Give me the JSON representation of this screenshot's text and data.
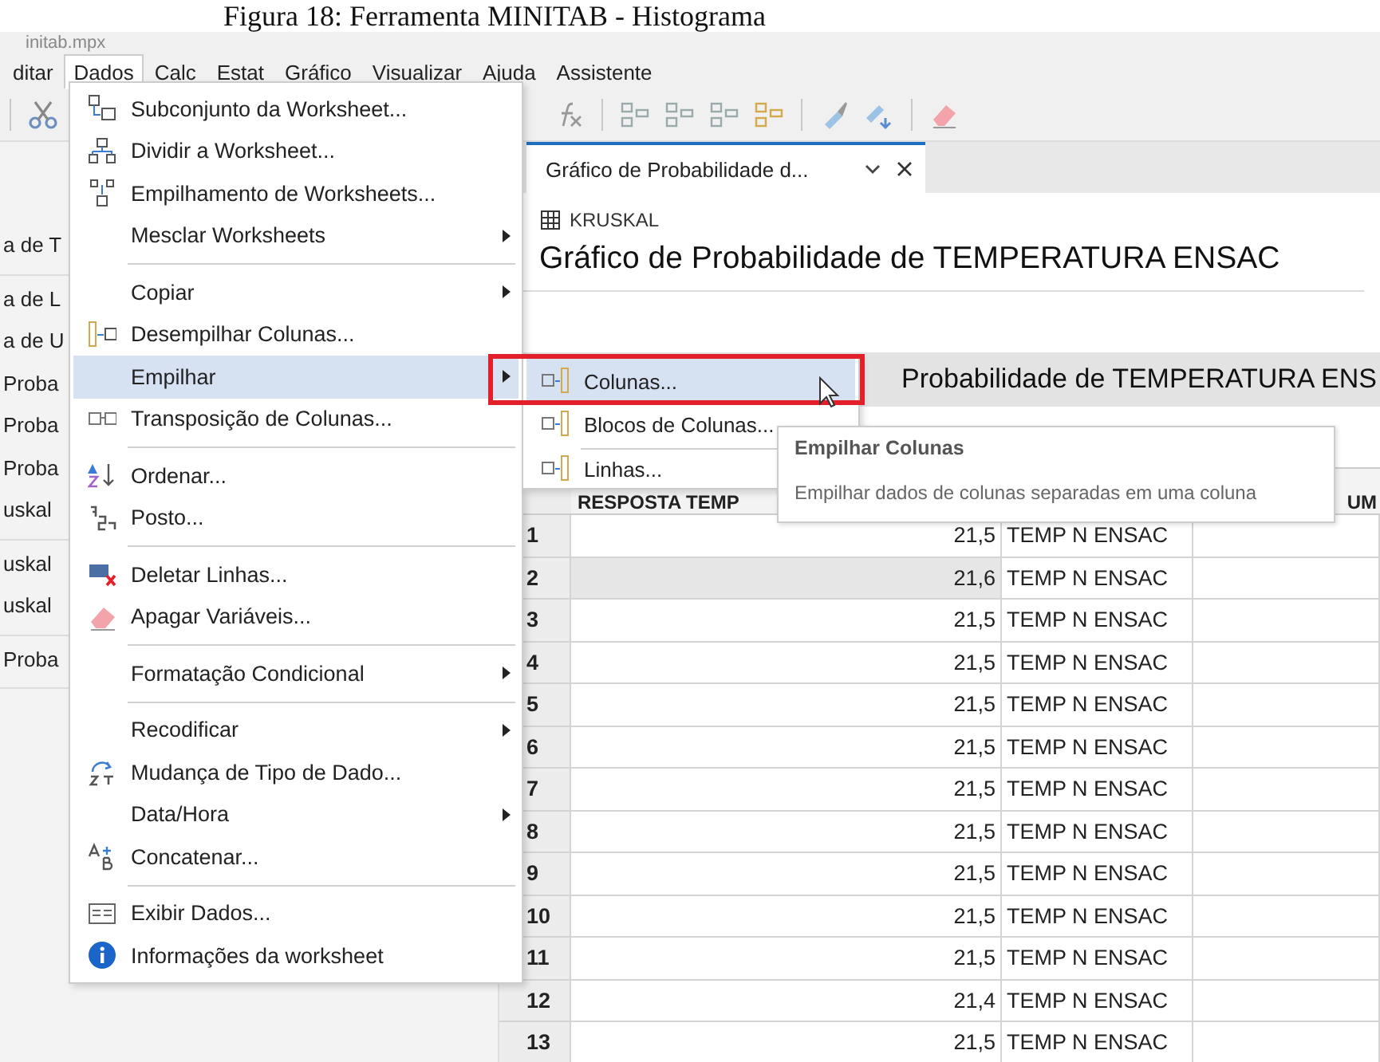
{
  "caption": "Figura 18: Ferramenta MINITAB - Histograma",
  "window": {
    "title": "initab.mpx"
  },
  "menubar": [
    {
      "label": "ditar",
      "selected": false
    },
    {
      "label": "Dados",
      "selected": true
    },
    {
      "label": "Calc",
      "selected": false
    },
    {
      "label": "Estat",
      "selected": false
    },
    {
      "label": "Gráfico",
      "selected": false
    },
    {
      "label": "Visualizar",
      "selected": false
    },
    {
      "label": "Ajuda",
      "selected": false
    },
    {
      "label": "Assistente",
      "selected": false
    }
  ],
  "navigator": {
    "groups": [
      [
        {
          "label": "a de T"
        }
      ],
      [
        {
          "label": "a de L"
        },
        {
          "label": "a de U"
        },
        {
          "label": "Proba"
        },
        {
          "label": "Proba"
        },
        {
          "label": "Proba"
        },
        {
          "label": "uskal"
        }
      ],
      [
        {
          "label": "uskal"
        },
        {
          "label": "uskal"
        }
      ],
      [
        {
          "label": "Proba"
        }
      ]
    ]
  },
  "document_tab": {
    "label": "Gráfico de Probabilidade d...",
    "selected": true
  },
  "worksheet": {
    "name": "KRUSKAL"
  },
  "output_title": "Gráfico de Probabilidade de TEMPERATURA ENSAC",
  "section_title": "Probabilidade de TEMPERATURA ENS",
  "table": {
    "header_1": "RESPOSTA TEMP",
    "header_3": "UM",
    "rows": [
      {
        "number": "1",
        "value": "21,5",
        "label": "TEMP N ENSAC",
        "selected": false
      },
      {
        "number": "2",
        "value": "21,6",
        "label": "TEMP N ENSAC",
        "selected": true
      },
      {
        "number": "3",
        "value": "21,5",
        "label": "TEMP N ENSAC",
        "selected": false
      },
      {
        "number": "4",
        "value": "21,5",
        "label": "TEMP N ENSAC",
        "selected": false
      },
      {
        "number": "5",
        "value": "21,5",
        "label": "TEMP N ENSAC",
        "selected": false
      },
      {
        "number": "6",
        "value": "21,5",
        "label": "TEMP N ENSAC",
        "selected": false
      },
      {
        "number": "7",
        "value": "21,5",
        "label": "TEMP N ENSAC",
        "selected": false
      },
      {
        "number": "8",
        "value": "21,5",
        "label": "TEMP N ENSAC",
        "selected": false
      },
      {
        "number": "9",
        "value": "21,5",
        "label": "TEMP N ENSAC",
        "selected": false
      },
      {
        "number": "10",
        "value": "21,5",
        "label": "TEMP N ENSAC",
        "selected": false
      },
      {
        "number": "11",
        "value": "21,5",
        "label": "TEMP N ENSAC",
        "selected": false
      },
      {
        "number": "12",
        "value": "21,4",
        "label": "TEMP N ENSAC",
        "selected": false
      },
      {
        "number": "13",
        "value": "21,5",
        "label": "TEMP N ENSAC",
        "selected": false
      }
    ]
  },
  "data_menu": {
    "items": [
      {
        "kind": "item",
        "label": "Subconjunto da Worksheet...",
        "submenu": false,
        "selected": false
      },
      {
        "kind": "item",
        "label": "Dividir a Worksheet...",
        "submenu": false,
        "selected": false
      },
      {
        "kind": "item",
        "label": "Empilhamento de Worksheets...",
        "submenu": false,
        "selected": false
      },
      {
        "kind": "item",
        "label": "Mesclar Worksheets",
        "submenu": true,
        "selected": false
      },
      {
        "kind": "separator"
      },
      {
        "kind": "item",
        "label": "Copiar",
        "submenu": true,
        "selected": false
      },
      {
        "kind": "item",
        "label": "Desempilhar Colunas...",
        "submenu": false,
        "selected": false
      },
      {
        "kind": "item",
        "label": "Empilhar",
        "submenu": true,
        "selected": true
      },
      {
        "kind": "item",
        "label": "Transposição de Colunas...",
        "submenu": false,
        "selected": false
      },
      {
        "kind": "separator"
      },
      {
        "kind": "item",
        "label": "Ordenar...",
        "submenu": false,
        "selected": false
      },
      {
        "kind": "item",
        "label": "Posto...",
        "submenu": false,
        "selected": false
      },
      {
        "kind": "separator"
      },
      {
        "kind": "item",
        "label": "Deletar Linhas...",
        "submenu": false,
        "selected": false
      },
      {
        "kind": "item",
        "label": "Apagar Variáveis...",
        "submenu": false,
        "selected": false
      },
      {
        "kind": "separator"
      },
      {
        "kind": "item",
        "label": "Formatação Condicional",
        "submenu": true,
        "selected": false
      },
      {
        "kind": "separator"
      },
      {
        "kind": "item",
        "label": "Recodificar",
        "submenu": true,
        "selected": false
      },
      {
        "kind": "item",
        "label": "Mudança de Tipo de Dado...",
        "submenu": false,
        "selected": false
      },
      {
        "kind": "item",
        "label": "Data/Hora",
        "submenu": true,
        "selected": false
      },
      {
        "kind": "item",
        "label": "Concatenar...",
        "submenu": false,
        "selected": false
      },
      {
        "kind": "separator"
      },
      {
        "kind": "item",
        "label": "Exibir Dados...",
        "submenu": false,
        "selected": false
      },
      {
        "kind": "item",
        "label": "Informações da worksheet",
        "submenu": false,
        "selected": false
      }
    ]
  },
  "stack_submenu": {
    "items": [
      {
        "kind": "item",
        "label": "Colunas...",
        "selected": true
      },
      {
        "kind": "item",
        "label": "Blocos de Colunas...",
        "selected": false
      },
      {
        "kind": "separator"
      },
      {
        "kind": "item",
        "label": "Linhas...",
        "selected": false
      }
    ]
  },
  "tooltip": {
    "title": "Empilhar Colunas",
    "text": "Empilhar dados de colunas separadas em uma coluna"
  }
}
